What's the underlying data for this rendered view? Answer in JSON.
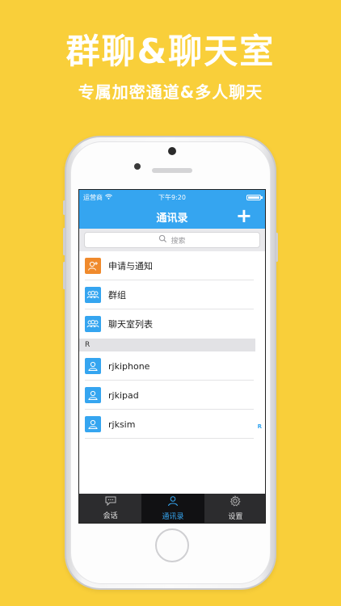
{
  "promo": {
    "headline": "群聊&聊天室",
    "subhead": "专属加密通道&多人聊天"
  },
  "status_bar": {
    "carrier": "运营商",
    "time": "下午9:20",
    "wifi_icon": "wifi-icon",
    "battery_icon": "battery-icon"
  },
  "nav": {
    "title": "通讯录",
    "add_label": "+"
  },
  "search": {
    "placeholder": "搜索"
  },
  "colors": {
    "background": "#F9CF3A",
    "accent": "#35a5f0",
    "request_icon_bg": "#f08a2c",
    "group_icon_bg": "#35a5f0",
    "tab_bar": "#2c2c2e"
  },
  "top_items": [
    {
      "label": "申请与通知",
      "icon": "add-user-icon"
    },
    {
      "label": "群组",
      "icon": "group-icon"
    },
    {
      "label": "聊天室列表",
      "icon": "group-icon"
    }
  ],
  "section": {
    "letter": "R",
    "index_letter": "R"
  },
  "contacts": [
    {
      "label": "rjkiphone",
      "icon": "user-icon"
    },
    {
      "label": "rjkipad",
      "icon": "user-icon"
    },
    {
      "label": "rjksim",
      "icon": "user-icon"
    }
  ],
  "tabs": [
    {
      "label": "会话",
      "icon": "chat-bubble-icon",
      "active": false
    },
    {
      "label": "通讯录",
      "icon": "contacts-icon",
      "active": true
    },
    {
      "label": "设置",
      "icon": "gear-icon",
      "active": false
    }
  ]
}
